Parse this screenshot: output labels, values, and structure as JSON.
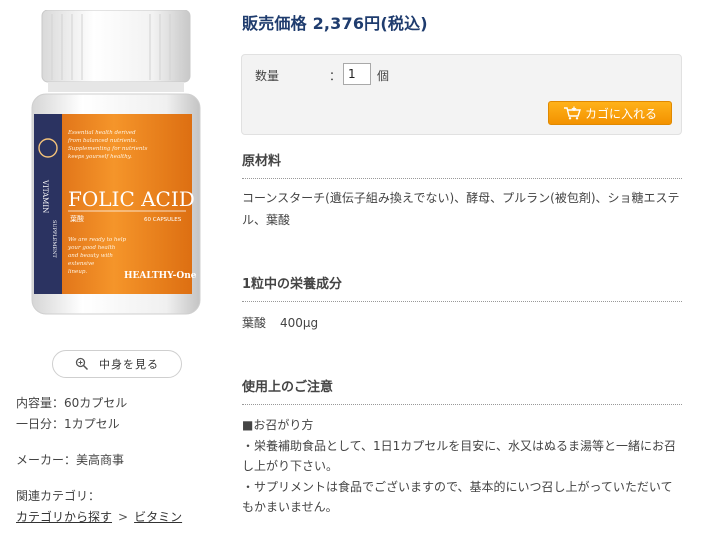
{
  "product_image": {
    "alt": "FOLIC ACID bottle",
    "side_text": "VITAMIN",
    "side_text2": "SUPPLEMENT",
    "brand_title": "FOLIC ACID",
    "jp_name": "葉酸",
    "capsules": "60 CAPSULES",
    "maker_logo": "HEALTHY-One",
    "copy_lines": [
      "Essential health derived",
      "from balanced nutrients.",
      "Supplementing for nutrients",
      "keeps yourself healthy."
    ],
    "copy_lines2": [
      "We are ready to help",
      "your good health",
      "and beauty with",
      "extensive",
      "lineup."
    ]
  },
  "zoom_button": {
    "label": "中身を見る",
    "icon": "magnifier-icon"
  },
  "specs": {
    "capacity": "内容量：60カプセル",
    "per_day": "一日分：1カプセル",
    "maker": "メーカー：美高商事",
    "category_label": "関連カテゴリ：",
    "category_root": "カテゴリから探す",
    "category_sep": ">",
    "category_leaf": "ビタミン"
  },
  "price": "販売価格 2,376円(税込)",
  "cart": {
    "qty_label": "数量",
    "qty_colon": "：",
    "qty_value": "1",
    "qty_unit": "個",
    "add_label": "カゴに入れる",
    "add_icon": "cart-icon"
  },
  "ingredients": {
    "title": "原材料",
    "text": "コーンスターチ(遺伝子組み換えでない)、酵母、プルラン(被包剤)、ショ糖エステル、葉酸"
  },
  "nutrition": {
    "title": "1粒中の栄養成分",
    "name": "葉酸",
    "amount": "400μg"
  },
  "caution": {
    "title": "使用上のご注意",
    "lines": [
      "■お召がり方",
      "・栄養補助食品として、1日1カプセルを目安に、水又はぬるま湯等と一緒にお召し上がり下さい。",
      "・サプリメントは食品でございますので、基本的にいつ召し上がっていただいてもかまいません。"
    ]
  },
  "colors": {
    "price": "#1f3c6e",
    "button_orange": "#f39200",
    "label_orange": "#f08a1c",
    "label_navy": "#2b3361"
  }
}
